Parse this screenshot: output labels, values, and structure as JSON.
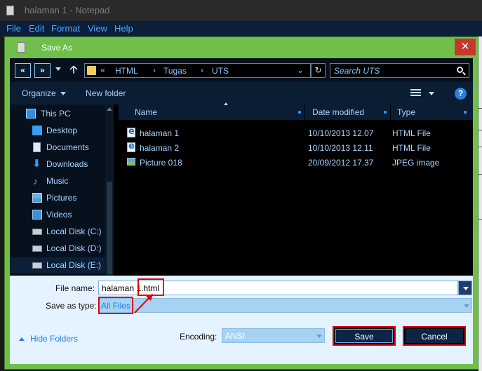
{
  "notepad": {
    "title": "halaman 1 - Notepad",
    "menu": [
      "File",
      "Edit",
      "Format",
      "View",
      "Help"
    ]
  },
  "dialog": {
    "title": "Save As",
    "close_label": "✕",
    "nav": {
      "back_label": "«",
      "forward_label": "»",
      "up_label": "🡡",
      "breadcrumb": [
        "HTML",
        "Tugas",
        "UTS"
      ],
      "breadcrumb_sep": "›",
      "root_sep": "«",
      "refresh_label": "↻",
      "search_placeholder": "Search UTS"
    },
    "toolbar": {
      "organize_label": "Organize",
      "new_folder_label": "New folder",
      "help_label": "?"
    },
    "sidebar": {
      "items": [
        {
          "label": "This PC",
          "icon": "pc-icon"
        },
        {
          "label": "Desktop",
          "icon": "desktop-icon"
        },
        {
          "label": "Documents",
          "icon": "documents-icon"
        },
        {
          "label": "Downloads",
          "icon": "downloads-icon"
        },
        {
          "label": "Music",
          "icon": "music-icon"
        },
        {
          "label": "Pictures",
          "icon": "pictures-icon"
        },
        {
          "label": "Videos",
          "icon": "videos-icon"
        },
        {
          "label": "Local Disk (C:)",
          "icon": "drive-icon"
        },
        {
          "label": "Local Disk (D:)",
          "icon": "drive-icon"
        },
        {
          "label": "Local Disk (E:)",
          "icon": "drive-icon"
        }
      ],
      "selected_index": 9
    },
    "files": {
      "columns": {
        "name": "Name",
        "date": "Date modified",
        "type": "Type"
      },
      "rows": [
        {
          "name": "halaman 1",
          "date": "10/10/2013 12.07",
          "type": "HTML File",
          "icon": "html-file-icon"
        },
        {
          "name": "halaman 2",
          "date": "10/10/2013 12.11",
          "type": "HTML File",
          "icon": "html-file-icon"
        },
        {
          "name": "Picture 018",
          "date": "20/09/2012 17.37",
          "type": "JPEG image",
          "icon": "image-file-icon"
        }
      ]
    },
    "form": {
      "file_name_label": "File name:",
      "file_name_value": "halaman 1.html",
      "save_type_label": "Save as type:",
      "save_type_value": "All Files",
      "hide_folders_label": "Hide Folders",
      "encoding_label": "Encoding:",
      "encoding_value": "ANSI",
      "save_label": "Save",
      "cancel_label": "Cancel"
    }
  },
  "colors": {
    "dialog_frame": "#6fbf4a",
    "highlight": "#e00000",
    "accent": "#1f7fde"
  }
}
